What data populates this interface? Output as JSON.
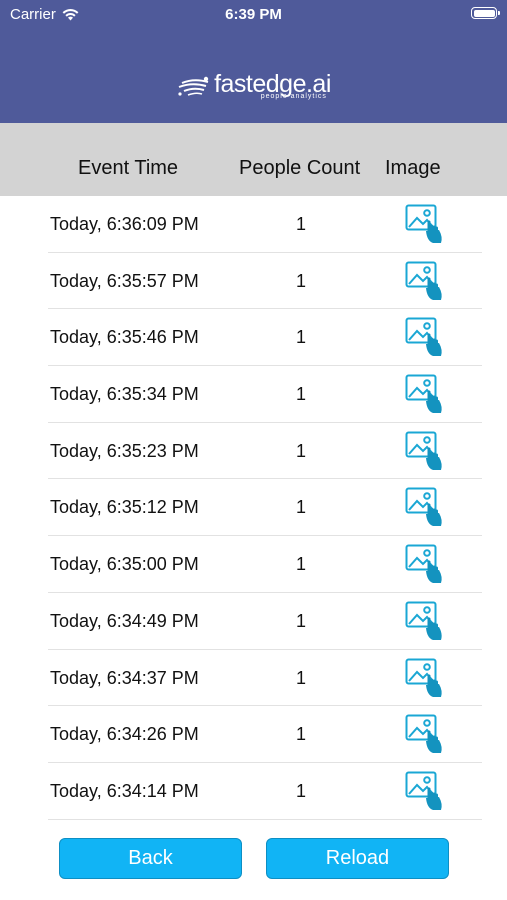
{
  "status_bar": {
    "carrier": "Carrier",
    "time": "6:39 PM"
  },
  "brand": {
    "name": "fastedge.ai",
    "tagline": "people analytics"
  },
  "table": {
    "headers": {
      "event_time": "Event Time",
      "people_count": "People Count",
      "image": "Image"
    },
    "rows": [
      {
        "event_time": "Today, 6:36:09 PM",
        "people_count": "1"
      },
      {
        "event_time": "Today, 6:35:57 PM",
        "people_count": "1"
      },
      {
        "event_time": "Today, 6:35:46 PM",
        "people_count": "1"
      },
      {
        "event_time": "Today, 6:35:34 PM",
        "people_count": "1"
      },
      {
        "event_time": "Today, 6:35:23 PM",
        "people_count": "1"
      },
      {
        "event_time": "Today, 6:35:12 PM",
        "people_count": "1"
      },
      {
        "event_time": "Today, 6:35:00 PM",
        "people_count": "1"
      },
      {
        "event_time": "Today, 6:34:49 PM",
        "people_count": "1"
      },
      {
        "event_time": "Today, 6:34:37 PM",
        "people_count": "1"
      },
      {
        "event_time": "Today, 6:34:26 PM",
        "people_count": "1"
      },
      {
        "event_time": "Today, 6:34:14 PM",
        "people_count": "1"
      }
    ]
  },
  "buttons": {
    "back": "Back",
    "reload": "Reload"
  },
  "icons": {
    "row_image": "image-tap-icon",
    "wifi": "wifi-icon",
    "battery": "battery-icon"
  },
  "colors": {
    "header_bg": "#4f5a9a",
    "column_header_bg": "#d3d3d3",
    "button_bg": "#11b4f5",
    "icon_accent": "#1aa7d4"
  }
}
